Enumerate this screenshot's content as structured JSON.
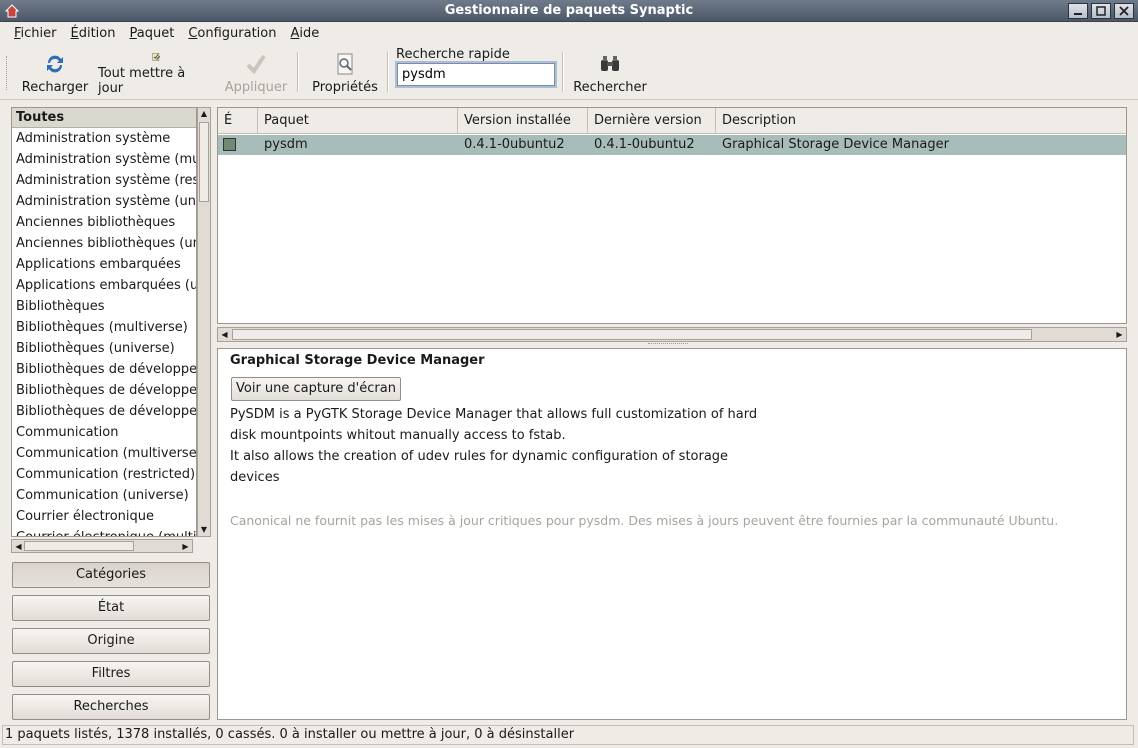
{
  "window": {
    "title": "Gestionnaire de paquets Synaptic"
  },
  "menu": [
    {
      "label": "Fichier",
      "key": "F",
      "rest": "ichier"
    },
    {
      "label": "Édition",
      "key": "É",
      "rest": "dition"
    },
    {
      "label": "Paquet",
      "key": "P",
      "rest": "aquet"
    },
    {
      "label": "Configuration",
      "key": "C",
      "rest": "onfiguration"
    },
    {
      "label": "Aide",
      "key": "A",
      "rest": "ide"
    }
  ],
  "toolbar": {
    "reload": "Recharger",
    "upgrade_all": "Tout mettre à jour",
    "apply": "Appliquer",
    "properties": "Propriétés",
    "quick_search_label": "Recherche rapide",
    "quick_search_value": "pysdm",
    "search": "Rechercher"
  },
  "sidebar": {
    "header": "Toutes",
    "items": [
      "Administration système",
      "Administration système (multiverse)",
      "Administration système (restricted)",
      "Administration système (universe)",
      "Anciennes bibliothèques",
      "Anciennes bibliothèques (universe)",
      "Applications embarquées",
      "Applications embarquées (universe)",
      "Bibliothèques",
      "Bibliothèques (multiverse)",
      "Bibliothèques (universe)",
      "Bibliothèques de développement",
      "Bibliothèques de développement",
      "Bibliothèques de développement",
      "Communication",
      "Communication (multiverse)",
      "Communication (restricted)",
      "Communication (universe)",
      "Courrier électronique",
      "Courrier électronique (multiverse)"
    ],
    "buttons": {
      "categories": "Catégories",
      "state": "État",
      "origin": "Origine",
      "filters": "Filtres",
      "searches": "Recherches"
    }
  },
  "packages": {
    "columns": {
      "status": "É",
      "name": "Paquet",
      "installed": "Version installée",
      "latest": "Dernière version",
      "description": "Description"
    },
    "rows": [
      {
        "name": "pysdm",
        "installed": "0.4.1-0ubuntu2",
        "latest": "0.4.1-0ubuntu2",
        "description": "Graphical Storage Device Manager"
      }
    ]
  },
  "details": {
    "title": "Graphical Storage Device Manager",
    "screenshot_button": "Voir une capture d'écran",
    "lines": [
      "PySDM is a PyGTK Storage Device Manager that allows full customization of hard",
      "disk mountpoints whitout manually access to fstab.",
      "It also allows the creation of udev rules for dynamic configuration of storage",
      "devices"
    ],
    "note": "Canonical ne fournit pas les mises à jour critiques pour pysdm. Des mises à jours peuvent être fournies par la communauté Ubuntu."
  },
  "status": {
    "text": "1 paquets listés, 1378 installés, 0 cassés. 0 à installer ou mettre à jour, 0 à désinstaller"
  },
  "colors": {
    "selected_row": "#a7bdba",
    "window_bg": "#efebe7",
    "titlebar": "#5d6878"
  }
}
